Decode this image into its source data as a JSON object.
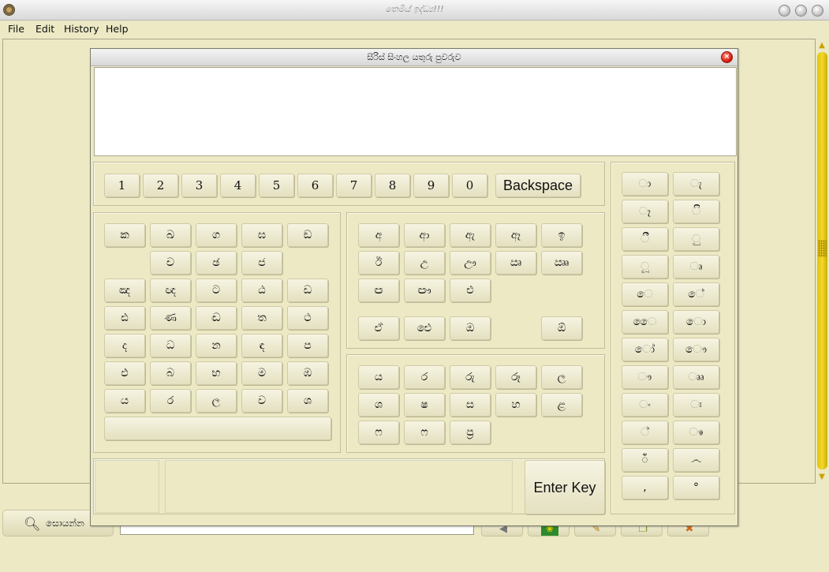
{
  "window": {
    "title": "තෙමිය් ඉද්ධ්‍ය!!!"
  },
  "menu": [
    "File",
    "Edit",
    "History",
    "Help"
  ],
  "dialog": {
    "title": "සීරිස් සිංහල යතුරු පුවරුව",
    "enter_label": "Enter Key",
    "backspace_label": "Backspace"
  },
  "search": {
    "label": "සොයන්න",
    "value": ""
  },
  "number_row": [
    "1",
    "2",
    "3",
    "4",
    "5",
    "6",
    "7",
    "8",
    "9",
    "0"
  ],
  "consonants": [
    [
      "ක",
      "ඛ",
      "ග",
      "ඝ",
      "ඞ"
    ],
    [
      "",
      "ච",
      "ඡ",
      "ජ",
      ""
    ],
    [
      "ඤ",
      "ඥ",
      "ට",
      "ඨ",
      "ඩ"
    ],
    [
      "ඪ",
      "ණ",
      "ඬ",
      "ත",
      "ථ"
    ],
    [
      "ද",
      "ධ",
      "න",
      "ඳ",
      "ප"
    ],
    [
      "ඵ",
      "බ",
      "භ",
      "ම",
      "ඹ"
    ],
    [
      "ය",
      "ර",
      "ල",
      "ව",
      "ශ"
    ]
  ],
  "vowels": [
    [
      "අ",
      "ආ",
      "ඇ",
      "ඈ",
      "ඉ"
    ],
    [
      "ඊ",
      "උ",
      "ඌ",
      "ඍ",
      "ඎ"
    ],
    [
      "ඏ",
      "ඐ",
      "එ",
      "",
      ""
    ],
    [
      "ඒ",
      "ඓ",
      "ඔ",
      "",
      "ඕ"
    ]
  ],
  "semi_vowels": [
    [
      "ය",
      "ර",
      "රු",
      "රූ",
      "ල"
    ],
    [
      "ශ",
      "ෂ",
      "ස",
      "හ",
      "ළ"
    ],
    [
      "ෆ",
      "ෆ",
      "ප්‍ර",
      "",
      ""
    ]
  ],
  "pillas": [
    [
      "ා",
      "ැ"
    ],
    [
      "ෑ",
      "ි"
    ],
    [
      "ී",
      "ු"
    ],
    [
      "ූ",
      "ෘ"
    ],
    [
      "ෙ",
      "ේ"
    ],
    [
      "ෛ",
      "ො"
    ],
    [
      "ෝ",
      "ෞ"
    ],
    [
      "ෟ",
      "ෲ"
    ],
    [
      "ං",
      "ඃ"
    ],
    [
      "්",
      "ෳ"
    ],
    [
      "ඁ",
      "෴"
    ],
    [
      ",",
      "°"
    ]
  ],
  "colors": {
    "accent": "#e5c200",
    "bg": "#ece9c4",
    "close": "#e01e10"
  },
  "toolbar_icons": [
    "speaker-icon",
    "flag-icon",
    "pencil-icon",
    "document-icon",
    "eraser-icon"
  ]
}
